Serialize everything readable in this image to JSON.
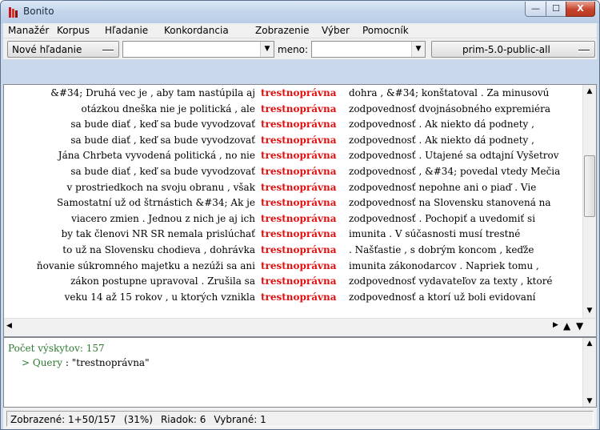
{
  "window": {
    "title": "Bonito",
    "controls": {
      "minimize": "—",
      "maximize": "☐",
      "close": "X"
    }
  },
  "menubar": {
    "items": [
      {
        "label": "Manažér"
      },
      {
        "label": "Korpus"
      },
      {
        "label": "Hľadanie"
      },
      {
        "label": "Konkordancia"
      },
      {
        "label": "Zobrazenie"
      },
      {
        "label": "Výber"
      },
      {
        "label": "Pomocník"
      }
    ]
  },
  "toolbar": {
    "new_search_label": "Nové hľadanie",
    "query_combo_value": "",
    "meno_label": "meno:",
    "meno_combo_value": "",
    "corpus_label": "prim-5.0-public-all"
  },
  "concordance": {
    "keyword": "trestnoprávna",
    "rows": [
      {
        "left": "&#34; Druhá vec je , aby tam nastúpila aj",
        "right": "dohra , &#34; konštatoval . Za minusovú"
      },
      {
        "left": "otázkou dneška nie je politická , ale",
        "right": "zodpovednosť dvojnásobného expremiéra"
      },
      {
        "left": "sa bude diať , keď sa bude vyvodzovať",
        "right": "zodpovednosť . Ak niekto dá podnety ,"
      },
      {
        "left": "sa bude diať , keď sa bude vyvodzovať",
        "right": "zodpovednosť . Ak niekto dá podnety ,"
      },
      {
        "left": "Jána Chrbeta vyvodená politická , no nie",
        "right": "zodpovednosť . Utajené sa odtajní Vyšetrov"
      },
      {
        "left": "sa bude diať , keď sa bude vyvodzovať",
        "right": "zodpovednosť , &#34; povedal vtedy Mečia"
      },
      {
        "left": "v prostriedkoch na svoju obranu , však",
        "right": "zodpovednosť nepohne ani o piaď . Vie"
      },
      {
        "left": "Samostatní už od štrnástich &#34; Ak je",
        "right": "zodpovednosť na Slovensku stanovená na"
      },
      {
        "left": "viacero zmien . Jednou z nich je aj ich",
        "right": "zodpovednosť . Pochopiť a uvedomiť si"
      },
      {
        "left": "by tak členovi NR SR nemala prislúchať",
        "right": "imunita . V súčasnosti musí trestné"
      },
      {
        "left": "to už na Slovensku chodieva , dohrávka",
        "right": ". Našťastie , s dobrým koncom , keďže"
      },
      {
        "left": "ňovanie súkromného majetku a nezúži sa ani",
        "right": "imunita zákonodarcov . Napriek tomu ,"
      },
      {
        "left": "zákon postupne upravoval . Zrušila sa",
        "right": "zodpovednosť vydavateľov za texty , ktoré"
      },
      {
        "left": "veku 14 až 15 rokov , u ktorých vznikla",
        "right": "zodpovednosť a ktorí už boli evidovaní"
      }
    ]
  },
  "info": {
    "count_line": "Počet výskytov: 157",
    "query_prefix": "> Query",
    "query_value": "  : \"trestnoprávna\""
  },
  "status": {
    "displayed": "Zobrazené: 1+50/157",
    "percent": "(31%)",
    "row": "Riadok: 6",
    "selected": "Vybrané: 1"
  }
}
